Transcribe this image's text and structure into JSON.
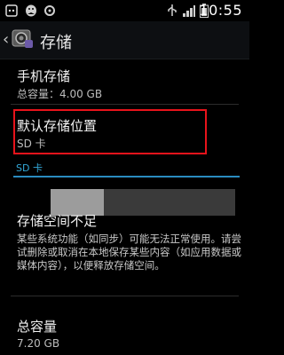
{
  "status_bar": {
    "time": "10:55",
    "icons": [
      "dots-icon",
      "bird-icon",
      "sync-icon",
      "usb-icon",
      "signal-icon",
      "battery-icon"
    ]
  },
  "action_bar": {
    "title": "存储"
  },
  "internal_storage": {
    "title": "手机存储",
    "total": "总容量：4.00 GB"
  },
  "default_location": {
    "title": "默认存储位置",
    "value": "SD 卡"
  },
  "sd_section": {
    "header": "SD 卡",
    "usage_fraction": 0.29
  },
  "low_storage": {
    "title": "存储空间不足",
    "message": "某些系统功能（如同步）可能无法正常使用。请尝试删除或取消在本地保存某些内容（如应用数据或媒体内容），以便释放存储空间。"
  },
  "sd_total": {
    "title": "总容量",
    "value": "7.20 GB"
  }
}
